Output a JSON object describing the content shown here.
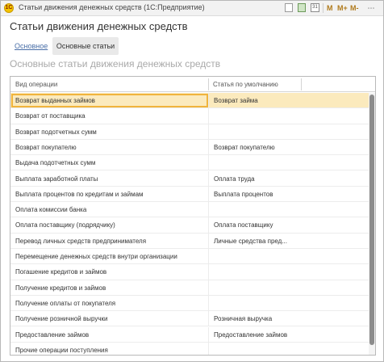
{
  "window": {
    "app_icon": "1C",
    "title": "Статьи движения денежных средств  (1С:Предприятие)",
    "toolbar": {
      "doc_icon": "document-icon",
      "calc_icon": "calculator-icon",
      "calendar_icon": "calendar-icon",
      "calendar_label": "31",
      "m_label": "M",
      "m_plus_label": "M+",
      "m_minus_label": "M-",
      "more_label": "⋯"
    }
  },
  "form": {
    "title": "Статьи движения денежных средств",
    "tabs": [
      {
        "label": "Основное",
        "active": false
      },
      {
        "label": "Основные статьи",
        "active": true
      }
    ],
    "group_title": "Основные статьи движения денежных средств"
  },
  "table": {
    "columns": [
      "Вид операции",
      "Статья по умолчанию"
    ],
    "selected_index": 0,
    "rows": [
      {
        "operation": "Возврат выданных займов",
        "article": "Возврат займа"
      },
      {
        "operation": "Возврат от поставщика",
        "article": ""
      },
      {
        "operation": "Возврат подотчетных сумм",
        "article": ""
      },
      {
        "operation": "Возврат покупателю",
        "article": "Возврат покупателю"
      },
      {
        "operation": "Выдача подотчетных сумм",
        "article": ""
      },
      {
        "operation": "Выплата заработной платы",
        "article": "Оплата труда"
      },
      {
        "operation": "Выплата процентов по кредитам и займам",
        "article": "Выплата процентов"
      },
      {
        "operation": "Оплата комиссии банка",
        "article": ""
      },
      {
        "operation": "Оплата поставщику (подрядчику)",
        "article": "Оплата поставщику"
      },
      {
        "operation": "Перевод личных средств предпринимателя",
        "article": "Личные средства пред..."
      },
      {
        "operation": "Перемещение денежных средств внутри организации",
        "article": ""
      },
      {
        "operation": "Погашение кредитов и займов",
        "article": ""
      },
      {
        "operation": "Получение кредитов и займов",
        "article": ""
      },
      {
        "operation": "Получение оплаты от покупателя",
        "article": ""
      },
      {
        "operation": "Получение розничной выручки",
        "article": "Розничная выручка"
      },
      {
        "operation": "Предоставление займов",
        "article": "Предоставление займов"
      },
      {
        "operation": "Прочие операции поступления",
        "article": ""
      }
    ]
  },
  "colors": {
    "selected_row": "#fbeabd",
    "selected_border": "#f0b43c",
    "link": "#4a6fa8",
    "group_title": "#a9a9a9"
  }
}
